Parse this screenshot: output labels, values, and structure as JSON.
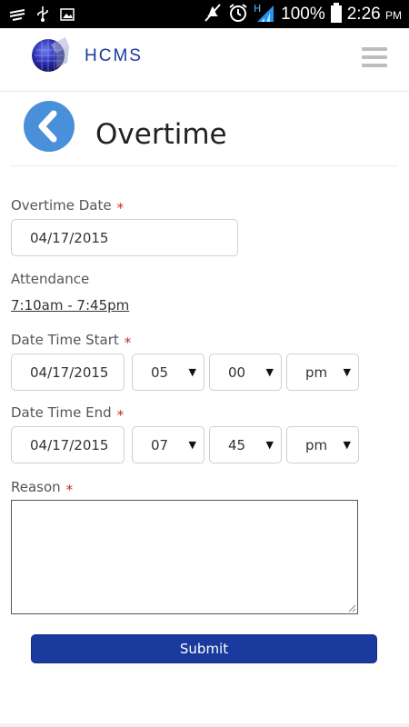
{
  "status_bar": {
    "battery_text": "100%",
    "time": "2:26",
    "time_suffix": "PM",
    "network_label": "H"
  },
  "header": {
    "app_title": "HCMS"
  },
  "page": {
    "title": "Overtime"
  },
  "form": {
    "overtime_date": {
      "label": "Overtime Date",
      "required_mark": "*",
      "value": "04/17/2015"
    },
    "attendance": {
      "label": "Attendance",
      "value": "7:10am - 7:45pm"
    },
    "date_time_start": {
      "label": "Date Time Start",
      "required_mark": "*",
      "date": "04/17/2015",
      "hour": "05",
      "minute": "00",
      "ampm": "pm"
    },
    "date_time_end": {
      "label": "Date Time End",
      "required_mark": "*",
      "date": "04/17/2015",
      "hour": "07",
      "minute": "45",
      "ampm": "pm"
    },
    "reason": {
      "label": "Reason",
      "required_mark": "*",
      "value": ""
    },
    "submit_label": "Submit"
  },
  "colors": {
    "brand": "#1a3aa0",
    "back_button": "#4a8fd9",
    "submit": "#1a3a9e",
    "required": "#c62828"
  }
}
